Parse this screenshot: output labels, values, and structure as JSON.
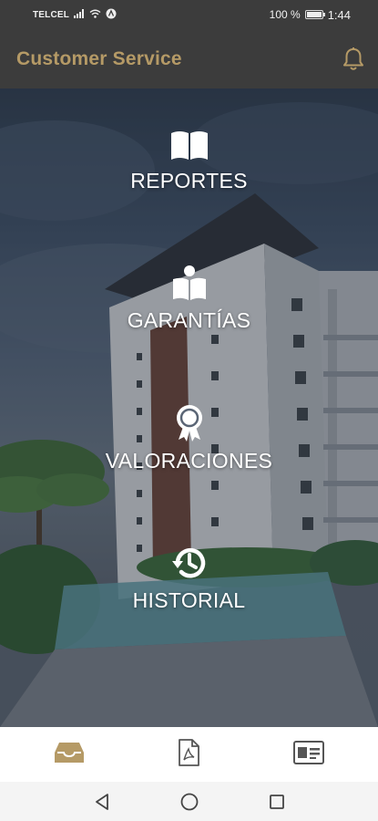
{
  "status_bar": {
    "carrier": "TELCEL",
    "battery_percent": "100 %",
    "time": "1:44"
  },
  "app_bar": {
    "title": "Customer Service",
    "title_color": "#b59a66"
  },
  "menu": {
    "items": [
      {
        "label": "REPORTES",
        "icon": "open-book-icon"
      },
      {
        "label": "GARANTÍAS",
        "icon": "person-book-icon"
      },
      {
        "label": "VALORACIONES",
        "icon": "award-ribbon-icon"
      },
      {
        "label": "HISTORIAL",
        "icon": "history-clock-icon"
      }
    ]
  },
  "bottom_nav": {
    "items": [
      {
        "icon": "inbox-icon",
        "active": true
      },
      {
        "icon": "pdf-file-icon",
        "active": false
      },
      {
        "icon": "id-card-icon",
        "active": false
      }
    ],
    "active_color": "#b59a66",
    "inactive_color": "#555555"
  },
  "system_nav": [
    "back-icon",
    "home-icon",
    "recents-icon"
  ]
}
